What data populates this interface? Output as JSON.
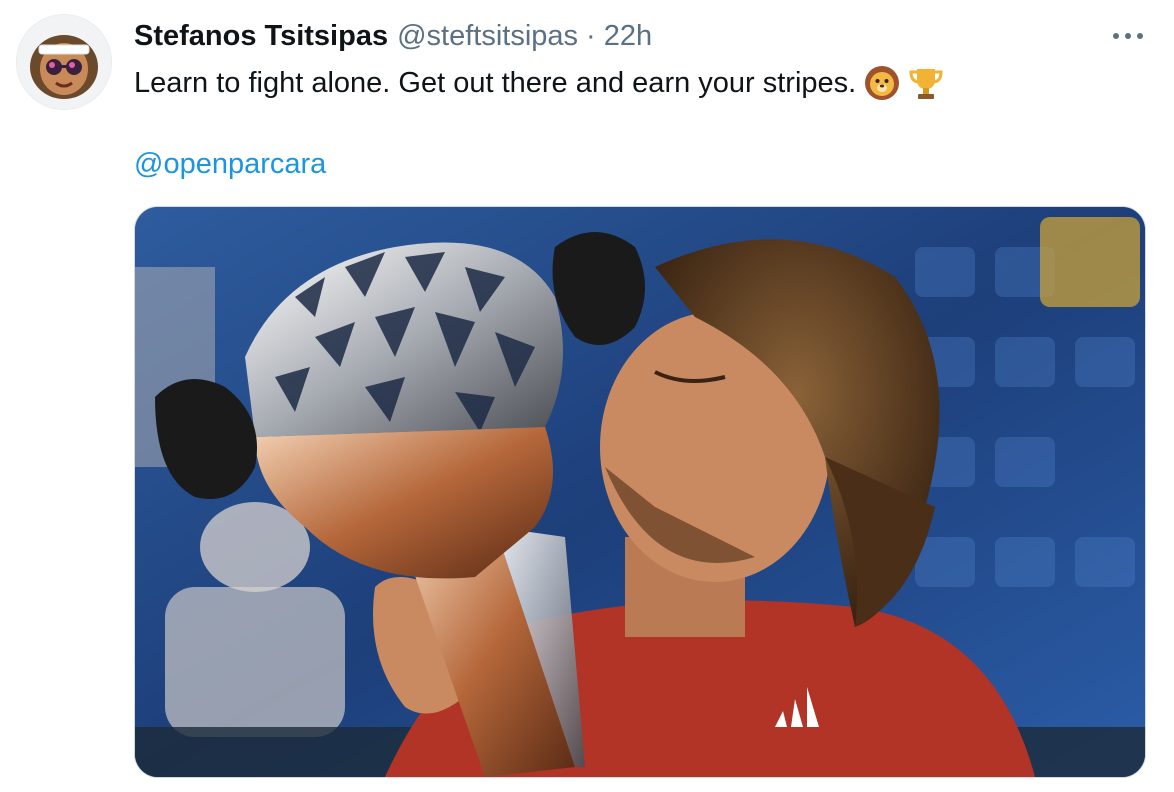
{
  "tweet": {
    "display_name": "Stefanos Tsitsipas",
    "handle": "@steftsitsipas",
    "separator": "·",
    "time": "22h",
    "text": "Learn to fight alone. Get out there and earn your stripes.",
    "emojis": [
      "lion-face-emoji",
      "trophy-emoji"
    ],
    "mention": "@openparcara",
    "more_icon": "more-horizontal-icon",
    "image_description": "photo"
  },
  "colors": {
    "text_primary": "#0f1419",
    "text_secondary": "#5b7083",
    "link": "#1b95e0",
    "border": "#cfd9de"
  }
}
